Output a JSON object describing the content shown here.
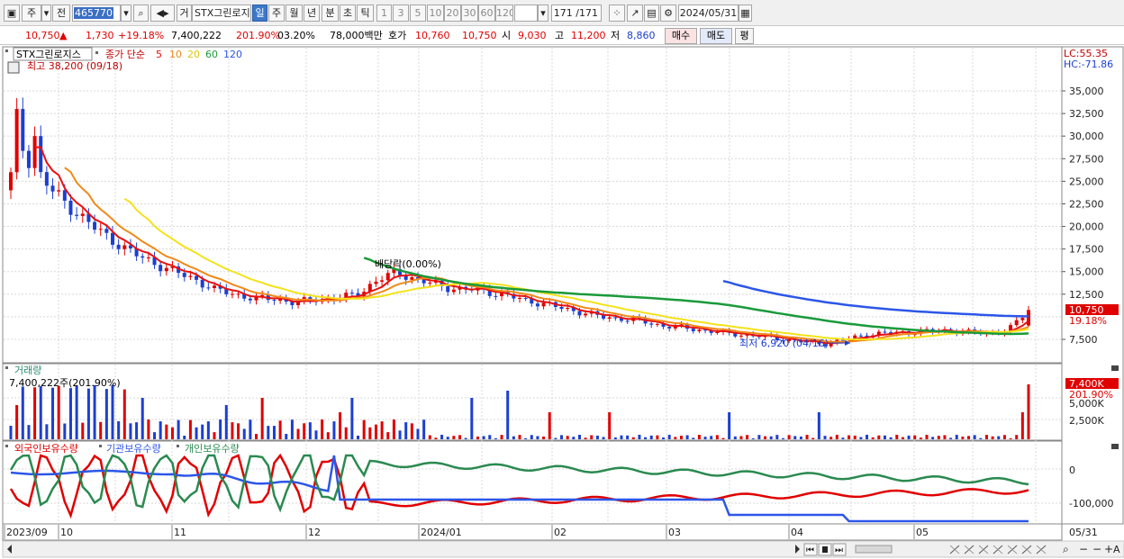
{
  "toolbar": {
    "period_unit": "주",
    "prev_label": "전",
    "stock_code": "465770",
    "stock_name": "STX그린로지",
    "trade_btn": "거",
    "period_tabs": [
      "일",
      "주",
      "월",
      "년",
      "분",
      "초",
      "틱"
    ],
    "active_period": "일",
    "num_tabs": [
      "1",
      "3",
      "5",
      "10",
      "20",
      "30",
      "60",
      "120"
    ],
    "count_display": "171 /171",
    "date": "2024/05/31"
  },
  "info": {
    "price": "10,750",
    "change": "1,730",
    "change_pct": "+19.18%",
    "volume": "7,400,222",
    "volume_ratio": "201.90%",
    "turnover": "03.20%",
    "amount": "78,000백만",
    "bid_label": "호가",
    "bid1": "10,760",
    "bid2": "10,750",
    "open_label": "시",
    "open": "9,030",
    "high_label": "고",
    "high": "11,200",
    "low_label": "저",
    "low": "8,860",
    "buy_btn": "매수",
    "sell_btn": "매도",
    "eval_btn": "평"
  },
  "price_panel": {
    "legend_name": "STX그린로지스",
    "legend_ma_label": "종가 단순",
    "ma_periods": [
      "5",
      "10",
      "20",
      "60",
      "120"
    ],
    "ma_colors": [
      "#e81010",
      "#f08a1a",
      "#f3e21a",
      "#1a9a3a",
      "#2c56e8"
    ],
    "high_note": "최고 38,200 (09/18)",
    "low_note": "최저 6,920 (04/16)",
    "dividend_note": "배당락(0.00%)",
    "lc_label": "LC:55.35",
    "hc_label": "HC:-71.86",
    "y_ticks": [
      "35,000",
      "32,500",
      "30,000",
      "27,500",
      "25,000",
      "22,500",
      "20,000",
      "17,500",
      "15,000",
      "12,500",
      "7,500"
    ],
    "price_tag": "10,750",
    "pct_tag": "19.18%"
  },
  "volume_panel": {
    "title": "거래량",
    "value_label": "7,400,222주(201.90%)",
    "y_ticks": [
      "5,000K",
      "2,500K"
    ],
    "tag_value": "7,400K",
    "tag_pct": "201.90%"
  },
  "holding_panel": {
    "legend": [
      "외국인보유수량",
      "기관보유수량",
      "개인보유수량"
    ],
    "legend_colors": [
      "#e00000",
      "#2c56e8",
      "#2a8a50"
    ],
    "y_ticks": [
      "0",
      "-100,000"
    ]
  },
  "x_axis": {
    "labels": [
      "2023/09",
      "10",
      "11",
      "12",
      "2024/01",
      "02",
      "03",
      "04",
      "05"
    ],
    "right_label": "05/31"
  },
  "chart_data": {
    "type": "candlestick",
    "stock": "STX그린로지스",
    "period": "daily",
    "y_range": [
      5500,
      40000
    ],
    "closes_approx": [
      31000,
      27000,
      24000,
      22000,
      20000,
      18500,
      17000,
      16000,
      15000,
      14200,
      13000,
      12500,
      12000,
      12000,
      11500,
      12000,
      12000,
      12500,
      14000,
      15000,
      14000,
      13500,
      13000,
      13000,
      12500,
      12000,
      11500,
      11000,
      10500,
      10000,
      9800,
      9500,
      9000,
      8800,
      8500,
      8200,
      8000,
      7800,
      7500,
      7200,
      7000,
      7500,
      8000,
      8200,
      8300,
      8400,
      8500,
      8300,
      8200,
      8500,
      10750
    ],
    "last": {
      "close": 10750,
      "open": 9030,
      "high": 11200,
      "low": 8860,
      "change": 1730,
      "change_pct": 19.18
    },
    "extremes": {
      "high": 38200,
      "high_date": "09/18",
      "low": 6920,
      "low_date": "04/16"
    }
  }
}
